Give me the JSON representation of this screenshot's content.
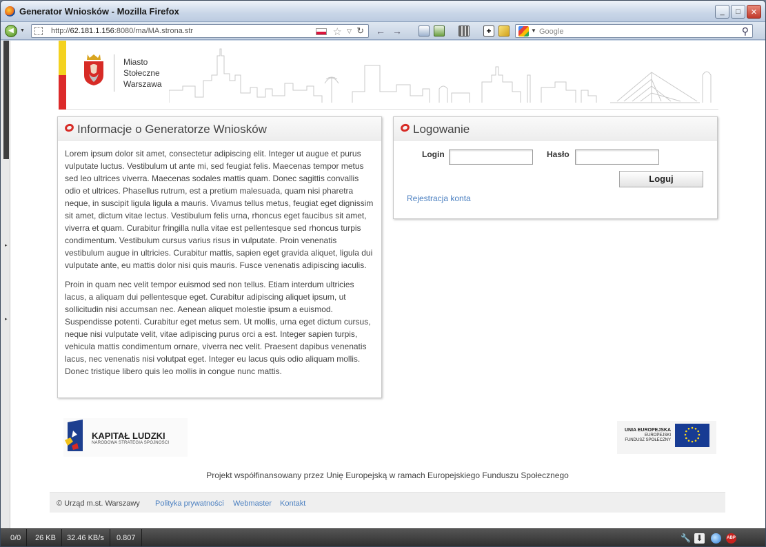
{
  "window": {
    "title": "Generator Wniosków - Mozilla Firefox",
    "buttons": {
      "minimize": "_",
      "maximize": "□",
      "close": "✕"
    }
  },
  "navbar": {
    "url_prefix": "http://",
    "url_host": "62.181.1.156",
    "url_rest": ":8080/ma/MA.strona.str",
    "search_placeholder": "Google",
    "icons": [
      "back-icon",
      "dropdown-icon",
      "site-identity-icon",
      "poland-flag-icon",
      "bookmark-star-icon",
      "history-dropdown-icon",
      "reload-icon",
      "back-arrow-icon",
      "forward-arrow-icon",
      "toolbar-tool-icons",
      "google-icon",
      "search-icon"
    ]
  },
  "header": {
    "logo_lines": [
      "Miasto",
      "Stołeczne",
      "Warszawa"
    ]
  },
  "info_panel": {
    "title": "Informacje o Generatorze Wniosków",
    "paragraphs": [
      "Lorem ipsum dolor sit amet, consectetur adipiscing elit. Integer ut augue et purus vulputate luctus. Vestibulum ut ante mi, sed feugiat felis. Maecenas tempor metus sed leo ultrices viverra. Maecenas sodales mattis quam. Donec sagittis convallis odio et ultrices. Phasellus rutrum, est a pretium malesuada, quam nisi pharetra neque, in suscipit ligula ligula a mauris. Vivamus tellus metus, feugiat eget dignissim sit amet, dictum vitae lectus. Vestibulum felis urna, rhoncus eget faucibus sit amet, viverra et quam. Curabitur fringilla nulla vitae est pellentesque sed rhoncus turpis condimentum. Vestibulum cursus varius risus in vulputate. Proin venenatis vestibulum augue in ultricies. Curabitur mattis, sapien eget gravida aliquet, ligula dui vulputate ante, eu mattis dolor nisi quis mauris. Fusce venenatis adipiscing iaculis.",
      "Proin in quam nec velit tempor euismod sed non tellus. Etiam interdum ultricies lacus, a aliquam dui pellentesque eget. Curabitur adipiscing aliquet ipsum, ut sollicitudin nisi accumsan nec. Aenean aliquet molestie ipsum a euismod. Suspendisse potenti. Curabitur eget metus sem. Ut mollis, urna eget dictum cursus, neque nisi vulputate velit, vitae adipiscing purus orci a est. Integer sapien turpis, vehicula mattis condimentum ornare, viverra nec velit. Praesent dapibus venenatis lacus, nec venenatis nisi volutpat eget. Integer eu lacus quis odio aliquam mollis. Donec tristique libero quis leo mollis in congue nunc mattis."
    ]
  },
  "login_panel": {
    "title": "Logowanie",
    "login_label": "Login",
    "login_value": "",
    "password_label": "Hasło",
    "password_value": "",
    "submit_label": "Loguj",
    "register_link": "Rejestracja konta"
  },
  "logos": {
    "kapital_title": "KAPITAŁ LUDZKI",
    "kapital_subtitle": "NARODOWA STRATEGIA SPÓJNOŚCI",
    "eu_line1": "UNIA EUROPEJSKA",
    "eu_line2": "EUROPEJSKI",
    "eu_line3": "FUNDUSZ SPOŁECZNY"
  },
  "cofinance_text": "Projekt współfinansowany przez Unię Europejską w ramach Europejskiego Funduszu Społecznego",
  "footer": {
    "copyright": "© Urząd m.st. Warszawy",
    "links": [
      "Polityka prywatności",
      "Webmaster",
      "Kontakt"
    ]
  },
  "statusbar": {
    "counter": "0/0",
    "size": "26 KB",
    "speed": "32.46 KB/s",
    "time": "0.807",
    "icons": [
      "wrench-icon",
      "download-icon",
      "globe-icon",
      "adblock-icon"
    ]
  },
  "colors": {
    "accent_red": "#d72b26",
    "link_blue": "#4a7fc0",
    "flag_yellow": "#f4d21f",
    "flag_red": "#dc2a2a",
    "eu_blue": "#173b93"
  }
}
